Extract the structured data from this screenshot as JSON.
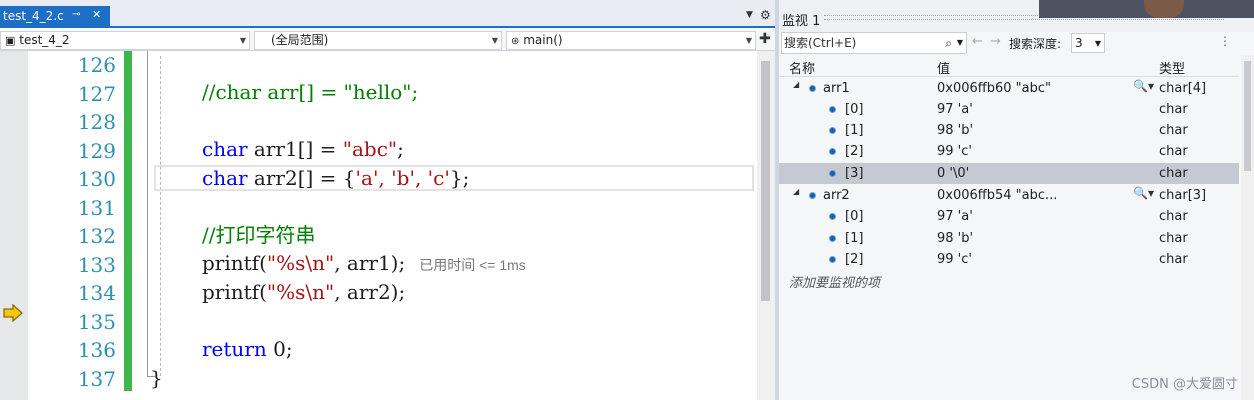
{
  "editor": {
    "tab": {
      "title": "test_4_2.c",
      "pin_glyph": "⊸",
      "close_glyph": "✕"
    },
    "navbar": {
      "project": "test_4_2",
      "scope": "(全局范围)",
      "member": "main()"
    },
    "lines": [
      {
        "num": "126"
      },
      {
        "num": "127",
        "code": "//char arr[] = \"hello\";"
      },
      {
        "num": "128"
      },
      {
        "num": "129",
        "code_kw": "char",
        "code_mid": " arr1[] = ",
        "code_str": "\"abc\"",
        "code_end": ";"
      },
      {
        "num": "130",
        "code_kw": "char",
        "code_mid": " arr2[] = {",
        "code_str": "'a', 'b', 'c'",
        "code_end": "};"
      },
      {
        "num": "131"
      },
      {
        "num": "132",
        "code": "//打印字符串"
      },
      {
        "num": "133",
        "code_pre": "printf(",
        "code_str": "\"%s\\n\"",
        "code_end": ", arr1);",
        "perf_tip": "已用时间 <= 1ms"
      },
      {
        "num": "134",
        "code_pre": "printf(",
        "code_str": "\"%s\\n\"",
        "code_end": ", arr2);"
      },
      {
        "num": "135"
      },
      {
        "num": "136",
        "code_kw": "return",
        "code_end": " 0;"
      },
      {
        "num": "137",
        "code": "}"
      }
    ]
  },
  "watch": {
    "title": "监视 1",
    "search_placeholder": "搜索(Ctrl+E)",
    "search_depth_label": "搜索深度:",
    "search_depth": "3",
    "columns": {
      "name": "名称",
      "value": "值",
      "type": "类型"
    },
    "rows": [
      {
        "name": "arr1",
        "value": "0x006ffb60 \"abc\"",
        "type": "char[4]"
      },
      {
        "name": "[0]",
        "value": "97 'a'",
        "type": "char"
      },
      {
        "name": "[1]",
        "value": "98 'b'",
        "type": "char"
      },
      {
        "name": "[2]",
        "value": "99 'c'",
        "type": "char"
      },
      {
        "name": "[3]",
        "value": "0 '\\0'",
        "type": "char"
      },
      {
        "name": "arr2",
        "value": "0x006ffb54 \"abc...",
        "type": "char[3]"
      },
      {
        "name": "[0]",
        "value": "97 'a'",
        "type": "char"
      },
      {
        "name": "[1]",
        "value": "98 'b'",
        "type": "char"
      },
      {
        "name": "[2]",
        "value": "99 'c'",
        "type": "char"
      }
    ],
    "add_item": "添加要监视的项"
  },
  "watermark": "CSDN @大爱圆寸",
  "colors": {
    "accent": "#1c6fc4",
    "change_bar": "#3fb74a",
    "keyword": "#0000ff",
    "string": "#a31515",
    "comment": "#008000",
    "line_number": "#2b91af"
  }
}
